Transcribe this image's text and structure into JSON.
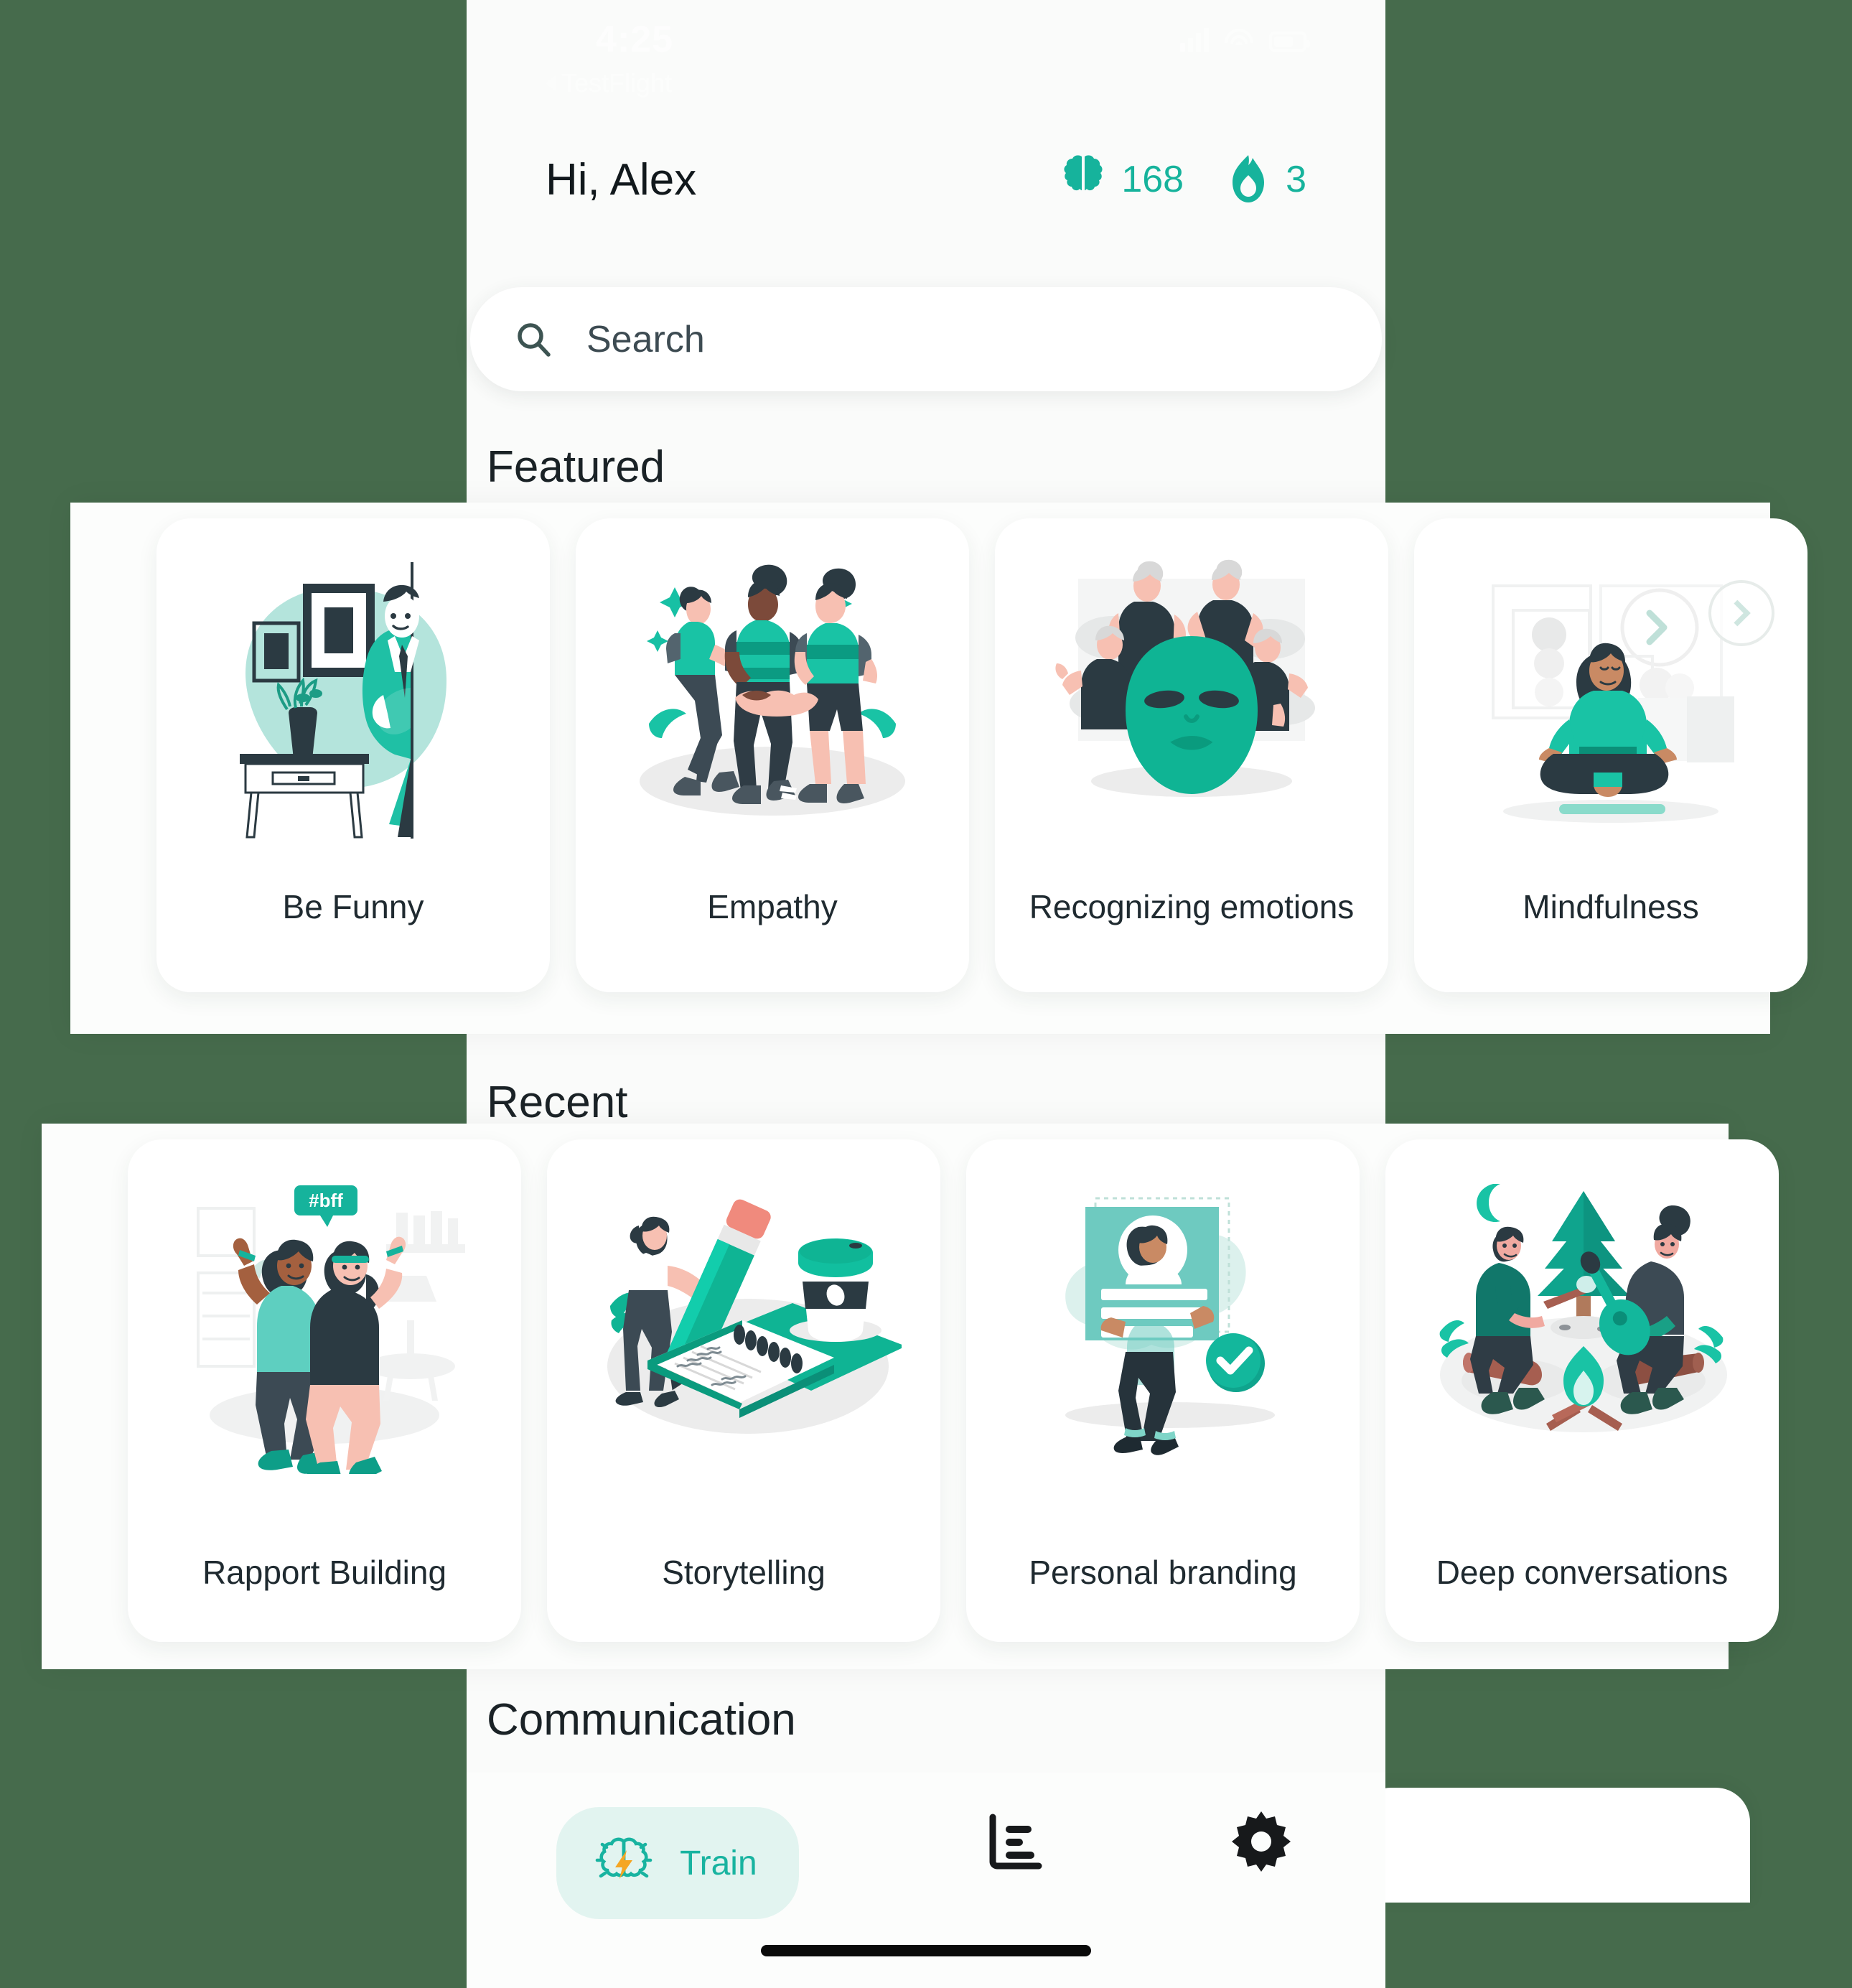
{
  "status_bar": {
    "time": "4:25",
    "back_label": "TestFlight",
    "signal_icon": "cellular-signal-icon",
    "wifi_icon": "wifi-icon",
    "battery_icon": "battery-icon"
  },
  "header": {
    "greeting": "Hi, Alex",
    "stats": [
      {
        "icon": "brain-icon",
        "value": "168",
        "name": "brain-points"
      },
      {
        "icon": "flame-icon",
        "value": "3",
        "name": "streak-days"
      }
    ]
  },
  "search": {
    "placeholder": "Search",
    "icon": "search-icon"
  },
  "sections": {
    "featured": {
      "title": "Featured"
    },
    "recent": {
      "title": "Recent"
    },
    "communication": {
      "title": "Communication"
    }
  },
  "featured_cards": [
    {
      "label": "Be Funny",
      "art": "man-peeking-door"
    },
    {
      "label": "Empathy",
      "art": "three-people-hands-together"
    },
    {
      "label": "Recognizing emotions",
      "art": "teal-mask-with-people"
    },
    {
      "label": "Mindfulness",
      "art": "woman-meditating"
    }
  ],
  "recent_cards": [
    {
      "label": "Rapport Building",
      "art": "two-friends-hugging-bff"
    },
    {
      "label": "Storytelling",
      "art": "woman-giant-pencil-notebook"
    },
    {
      "label": "Personal branding",
      "art": "person-holding-profile-card"
    },
    {
      "label": "Deep conversations",
      "art": "campfire-night-scene"
    }
  ],
  "featured_next_button": {
    "icon": "chevron-right-icon"
  },
  "bottom_nav": [
    {
      "label": "Train",
      "icon": "brain-bolt-icon",
      "active": true,
      "name": "nav-train"
    },
    {
      "label": "",
      "icon": "bar-chart-icon",
      "active": false,
      "name": "nav-stats"
    },
    {
      "label": "",
      "icon": "gear-icon",
      "active": false,
      "name": "nav-settings"
    }
  ],
  "colors": {
    "teal": "#16b39c",
    "teal_dark": "#0e8f7c",
    "mint_pill": "#e2f4f0",
    "orange_bolt": "#f5a623",
    "ink": "#1f2a30",
    "page_bg": "#fafbfa",
    "backdrop": "#466b4c"
  },
  "bff_badge": "#bff"
}
